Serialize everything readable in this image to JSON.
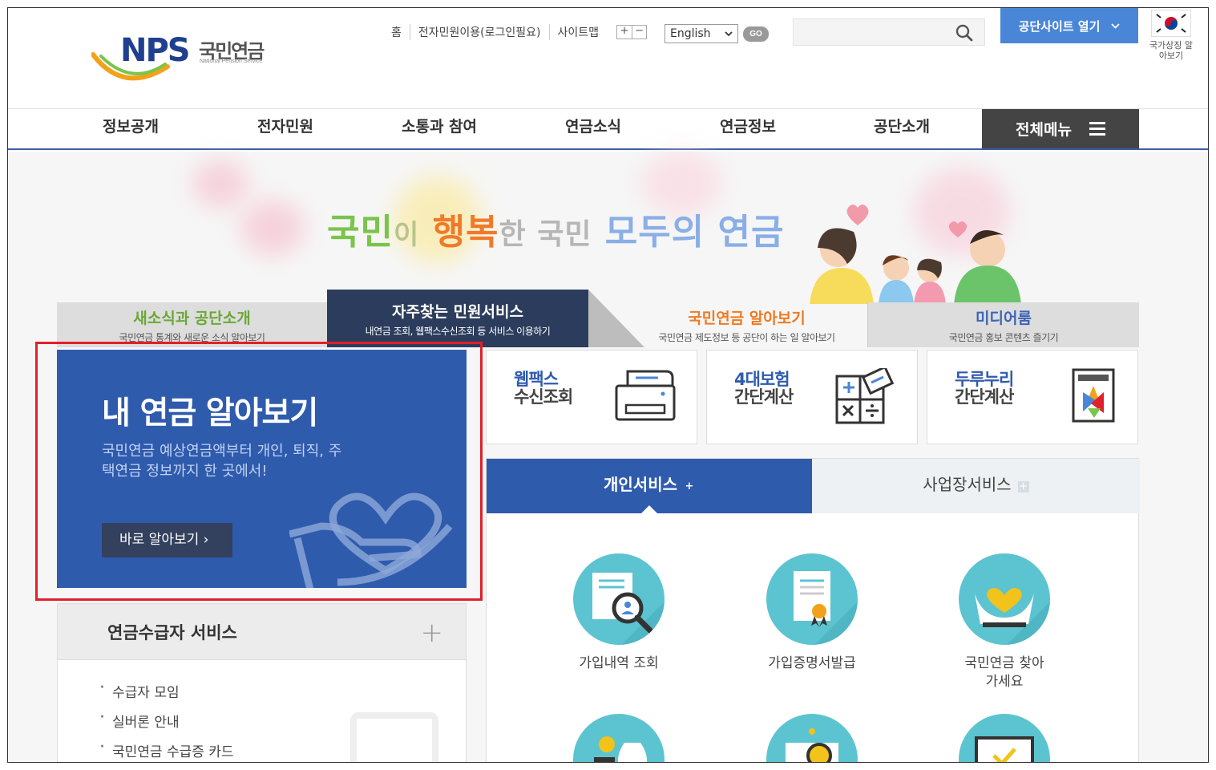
{
  "header": {
    "logo_mark": "NPS",
    "logo_kr": "국민연금",
    "logo_en": "National Pension Service",
    "util_links": [
      "홈",
      "전자민원이용(로그인필요)",
      "사이트맵"
    ],
    "zoom_in": "+",
    "zoom_out": "−",
    "language": "English",
    "go_label": "GO",
    "search_placeholder": "",
    "site_open": "공단사이트 열기",
    "national_symbol": "국가상징 알아보기"
  },
  "gnb": {
    "items": [
      "정보공개",
      "전자민원",
      "소통과 참여",
      "연금소식",
      "연금정보",
      "공단소개"
    ],
    "all_menu": "전체메뉴"
  },
  "hero": {
    "slogan": [
      "국민",
      "이",
      "행복",
      "한 국민",
      "모두의 연금"
    ]
  },
  "tabs": [
    {
      "title": "새소식과 공단소개",
      "desc": "국민연금 통계와 새로운 소식 알아보기"
    },
    {
      "title": "자주찾는 민원서비스",
      "desc": "내연금 조회, 웹팩스수신조회 등 서비스 이용하기"
    },
    {
      "title": "국민연금 알아보기",
      "desc": "국민연금 제도정보 등 공단이 하는 일 알아보기"
    },
    {
      "title": "미디어룸",
      "desc": "국민연금 홍보 콘텐츠 즐기기"
    }
  ],
  "my_pension": {
    "title": "내 연금 알아보기",
    "desc": "국민연금 예상연금액부터 개인, 퇴직, 주택연금 정보까지 한 곳에서!",
    "button": "바로 알아보기 ›"
  },
  "recipient": {
    "title": "연금수급자 서비스",
    "plus": "+",
    "items": [
      "수급자 모임",
      "실버론 안내",
      "국민연금 수급증 카드"
    ]
  },
  "quick": [
    {
      "line1": "웹팩스",
      "line2": "수신조회"
    },
    {
      "line1": "4대보험",
      "line2": "간단계산"
    },
    {
      "line1": "두루누리",
      "line2": "간단계산"
    }
  ],
  "service_tabs": {
    "personal": "개인서비스",
    "business": "사업장서비스"
  },
  "services": [
    "가입내역 조회",
    "가입증명서발급",
    "국민연금 찾아가세요"
  ],
  "colors": {
    "brand_blue": "#2f5bad",
    "nav_dark": "#444444",
    "highlight_red": "#e0202a",
    "teal": "#5cc4d0"
  }
}
